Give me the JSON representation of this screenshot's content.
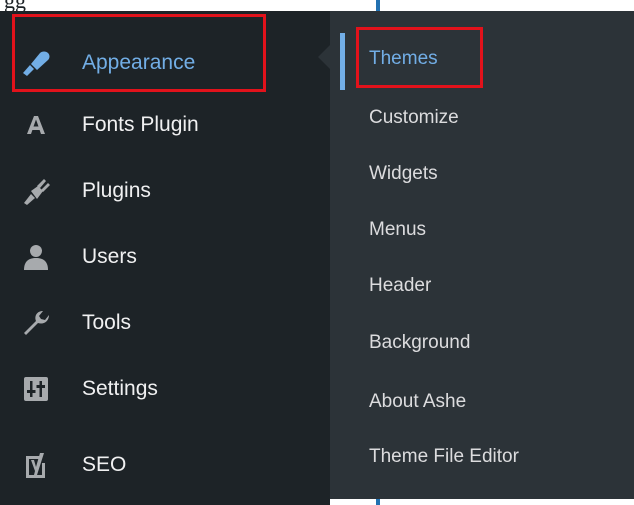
{
  "top_fragment": "gg",
  "sidebar": {
    "items": [
      {
        "label": "Appearance",
        "icon": "paintbrush-icon",
        "active": true
      },
      {
        "label": "Fonts Plugin",
        "icon": "letter-a-icon"
      },
      {
        "label": "Plugins",
        "icon": "plug-icon"
      },
      {
        "label": "Users",
        "icon": "user-icon"
      },
      {
        "label": "Tools",
        "icon": "wrench-icon"
      },
      {
        "label": "Settings",
        "icon": "sliders-icon"
      },
      {
        "label": "SEO",
        "icon": "yoast-icon"
      }
    ]
  },
  "submenu": {
    "items": [
      {
        "label": "Themes",
        "current": true
      },
      {
        "label": "Customize"
      },
      {
        "label": "Widgets"
      },
      {
        "label": "Menus"
      },
      {
        "label": "Header"
      },
      {
        "label": "Background"
      },
      {
        "label": "About Ashe"
      },
      {
        "label": "Theme File Editor"
      }
    ]
  },
  "colors": {
    "sidebar_bg": "#1d2327",
    "submenu_bg": "#2c3338",
    "active_text": "#72aee6",
    "text": "#f0f0f1",
    "highlight_border": "#e2121b"
  }
}
